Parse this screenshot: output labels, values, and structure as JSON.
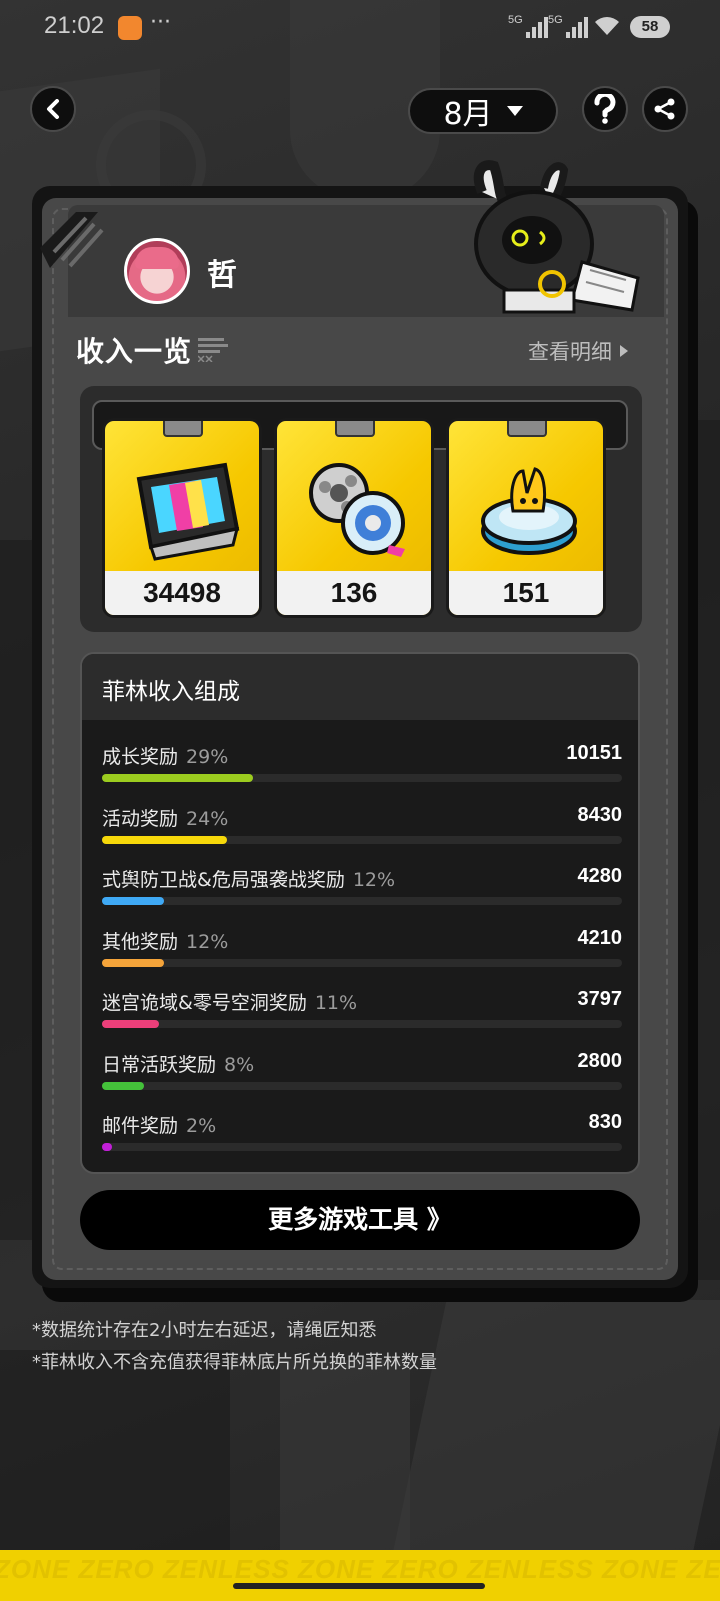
{
  "status_bar": {
    "time": "21:02",
    "more_dots": "···",
    "signal_1_label": "5G",
    "signal_2_label": "5G",
    "battery": "58"
  },
  "nav": {
    "month": "8月"
  },
  "profile": {
    "name": "哲"
  },
  "income": {
    "title": "收入一览",
    "detail_link": "查看明细"
  },
  "tiles": [
    {
      "icon": "film-reel-icon",
      "value": "34498"
    },
    {
      "icon": "film-rolls-icon",
      "value": "136"
    },
    {
      "icon": "bangboo-badge-icon",
      "value": "151"
    }
  ],
  "breakdown": {
    "title": "菲林收入组成",
    "rows": [
      {
        "label": "成长奖励",
        "percent": "29%",
        "percent_value": 29,
        "value": "10151",
        "color": "#9ccc1f"
      },
      {
        "label": "活动奖励",
        "percent": "24%",
        "percent_value": 24,
        "value": "8430",
        "color": "#f6d80a"
      },
      {
        "label": "式舆防卫战&危局强袭战奖励",
        "percent": "12%",
        "percent_value": 12,
        "value": "4280",
        "color": "#3fa9f5"
      },
      {
        "label": "其他奖励",
        "percent": "12%",
        "percent_value": 12,
        "value": "4210",
        "color": "#f5a43a"
      },
      {
        "label": "迷宫诡域&零号空洞奖励",
        "percent": "11%",
        "percent_value": 11,
        "value": "3797",
        "color": "#ec3f7a"
      },
      {
        "label": "日常活跃奖励",
        "percent": "8%",
        "percent_value": 8,
        "value": "2800",
        "color": "#44c23a"
      },
      {
        "label": "邮件奖励",
        "percent": "2%",
        "percent_value": 2,
        "value": "830",
        "color": "#c21fd8"
      }
    ]
  },
  "more_button": "更多游戏工具 》",
  "notes": [
    "*数据统计存在2小时左右延迟，请绳匠知悉",
    "*菲林收入不含充值获得菲林底片所兑换的菲林数量"
  ],
  "banner_text": "ZONE ZERO ZENLESS ZONE ZERO ZENLESS ZONE ZERO"
}
